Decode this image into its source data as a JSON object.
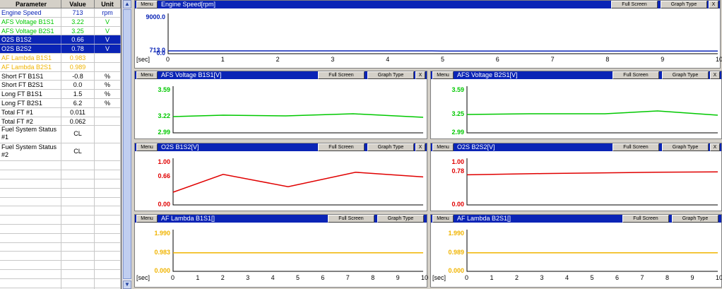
{
  "params": {
    "headers": [
      "Parameter",
      "Value",
      "Unit"
    ],
    "rows": [
      {
        "name": "Engine Speed",
        "value": "713",
        "unit": "rpm",
        "color": "#0a24b6"
      },
      {
        "name": "AFS Voltage B1S1",
        "value": "3.22",
        "unit": "V",
        "color": "#00c800"
      },
      {
        "name": "AFS Voltage B2S1",
        "value": "3.25",
        "unit": "V",
        "color": "#00c800"
      },
      {
        "name": "O2S B1S2",
        "value": "0.66",
        "unit": "V",
        "color": "#ffffff",
        "selected": true
      },
      {
        "name": "O2S B2S2",
        "value": "0.78",
        "unit": "V",
        "color": "#ffffff",
        "selected": true
      },
      {
        "name": "AF Lambda B1S1",
        "value": "0.983",
        "unit": "",
        "color": "#f0b400"
      },
      {
        "name": "AF Lambda B2S1",
        "value": "0.989",
        "unit": "",
        "color": "#f0b400"
      },
      {
        "name": "Short FT B1S1",
        "value": "-0.8",
        "unit": "%",
        "color": "#000000"
      },
      {
        "name": "Short FT B2S1",
        "value": "0.0",
        "unit": "%",
        "color": "#000000"
      },
      {
        "name": "Long FT B1S1",
        "value": "1.5",
        "unit": "%",
        "color": "#000000"
      },
      {
        "name": "Long FT B2S1",
        "value": "6.2",
        "unit": "%",
        "color": "#000000"
      },
      {
        "name": "Total FT #1",
        "value": "0.011",
        "unit": "",
        "color": "#000000"
      },
      {
        "name": "Total FT #2",
        "value": "0.062",
        "unit": "",
        "color": "#000000"
      },
      {
        "name": "Fuel System Status #1",
        "value": "CL",
        "unit": "",
        "color": "#000000",
        "tall": true
      },
      {
        "name": "Fuel System Status #2",
        "value": "CL",
        "unit": "",
        "color": "#000000",
        "tall": true
      }
    ],
    "empty_rows": 15
  },
  "buttons": {
    "menu": "Menu",
    "full_screen": "Full Screen",
    "graph_type": "Graph Type",
    "close": "X"
  },
  "x_unit_label": "[sec]",
  "x_ticks": [
    "0",
    "1",
    "2",
    "3",
    "4",
    "5",
    "6",
    "7",
    "8",
    "9",
    "10"
  ],
  "chart_data": [
    {
      "id": "engine",
      "title": "Engine Speed[rpm]",
      "type": "line",
      "color": "#0a24b6",
      "yticks": [
        "9000.0",
        "713.0",
        "0.0"
      ],
      "ylim": [
        0,
        9000
      ],
      "x": [
        0,
        4.8,
        5,
        10
      ],
      "y": [
        713,
        713,
        650,
        650
      ]
    },
    {
      "id": "afs1",
      "title": "AFS Voltage B1S1[V]",
      "type": "line",
      "color": "#00c800",
      "yticks": [
        "3.59",
        "3.22",
        "2.99"
      ],
      "ylim": [
        2.99,
        3.59
      ],
      "x": [
        0,
        2,
        4.5,
        7.2,
        10
      ],
      "y": [
        3.22,
        3.24,
        3.23,
        3.26,
        3.21
      ]
    },
    {
      "id": "afs2",
      "title": "AFS Voltage B2S1[V]",
      "type": "line",
      "color": "#00c800",
      "yticks": [
        "3.59",
        "3.25",
        "2.99"
      ],
      "ylim": [
        2.99,
        3.59
      ],
      "x": [
        0,
        2.5,
        5.5,
        7.6,
        10
      ],
      "y": [
        3.25,
        3.26,
        3.26,
        3.3,
        3.24
      ]
    },
    {
      "id": "o2s1",
      "title": "O2S B1S2[V]",
      "type": "line",
      "color": "#e00000",
      "yticks": [
        "1.00",
        "0.66",
        "0.00"
      ],
      "ylim": [
        0,
        1
      ],
      "x": [
        0,
        2,
        4.6,
        7.3,
        10
      ],
      "y": [
        0.3,
        0.72,
        0.43,
        0.77,
        0.66
      ]
    },
    {
      "id": "o2s2",
      "title": "O2S B2S2[V]",
      "type": "line",
      "color": "#e00000",
      "yticks": [
        "1.00",
        "0.78",
        "0.00"
      ],
      "ylim": [
        0,
        1
      ],
      "x": [
        0,
        3,
        7.5,
        10
      ],
      "y": [
        0.71,
        0.74,
        0.77,
        0.78
      ]
    },
    {
      "id": "lam1",
      "title": "AF Lambda B1S1[]",
      "type": "line",
      "color": "#f0b400",
      "yticks": [
        "1.990",
        "0.983",
        "0.000"
      ],
      "ylim": [
        0,
        1.99
      ],
      "x": [
        0,
        10
      ],
      "y": [
        0.983,
        0.983
      ]
    },
    {
      "id": "lam2",
      "title": "AF Lambda B2S1[]",
      "type": "line",
      "color": "#f0b400",
      "yticks": [
        "1.990",
        "0.989",
        "0.000"
      ],
      "ylim": [
        0,
        1.99
      ],
      "x": [
        0,
        10
      ],
      "y": [
        0.989,
        0.989
      ]
    }
  ]
}
